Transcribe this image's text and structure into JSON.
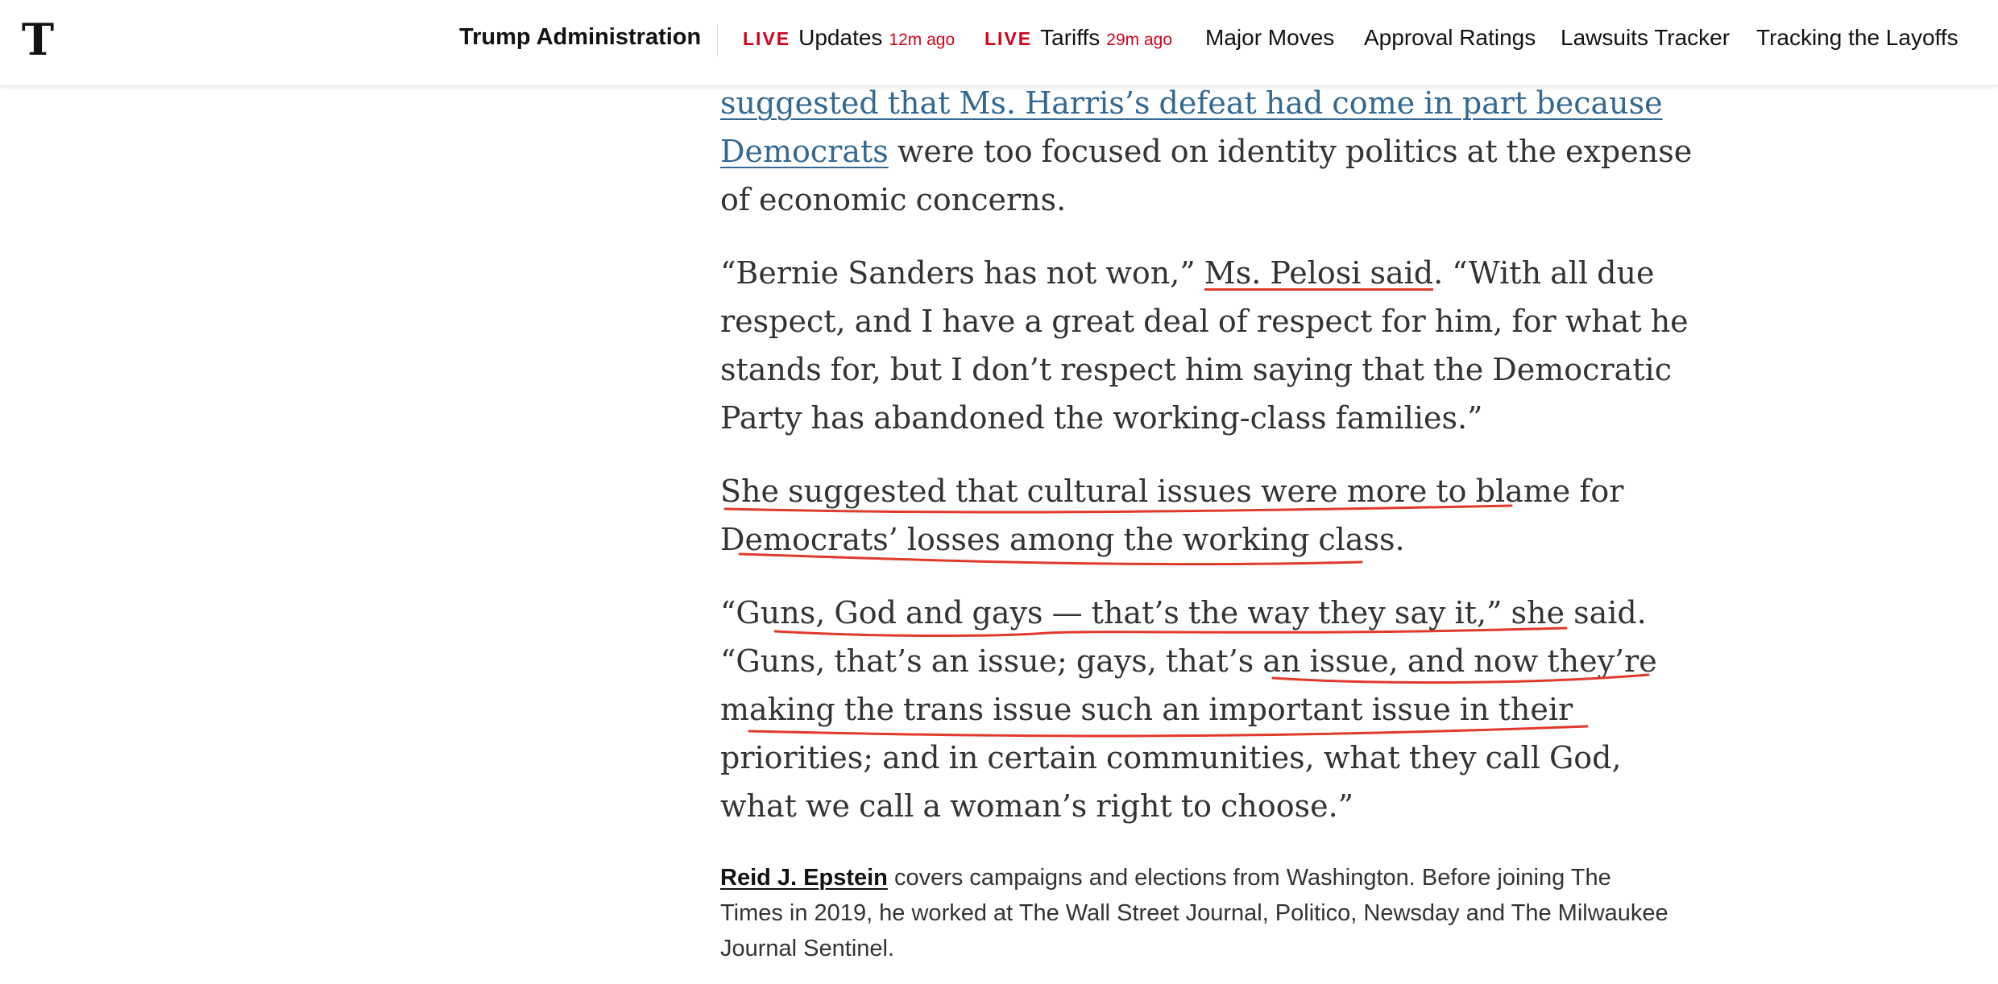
{
  "header": {
    "logo_letter": "T",
    "section_title": "Trump Administration",
    "nav": [
      {
        "live": "LIVE",
        "label": "Updates",
        "time": "12m ago"
      },
      {
        "live": "LIVE",
        "label": "Tariffs",
        "time": "29m ago"
      },
      {
        "label": "Major Moves"
      },
      {
        "label": "Approval Ratings"
      },
      {
        "label": "Lawsuits Tracker"
      },
      {
        "label": "Tracking the Layoffs"
      }
    ]
  },
  "article": {
    "p1": {
      "link_line1": "suggested that Ms. Harris’s defeat had come in part because",
      "link_line2": "Democrats",
      "rest": " were too focused on identity politics at the expense of economic concerns."
    },
    "p2": {
      "a": "“Bernie Sanders has not won,” ",
      "marked": "Ms. Pelosi said",
      "b": ". “With all due respect, and I have a great deal of respect for him, for what he stands for, but I don’t respect him saying that the Democratic Party has abandoned the working-class families.”"
    },
    "p3": {
      "text": "She suggested that cultural issues were more to blame for Democrats’ losses among the working class."
    },
    "p4": {
      "text": "“Guns, God and gays — that’s the way they say it,” she said. “Guns, that’s an issue; gays, that’s an issue, and now they’re making the trans issue such an important issue in their priorities; and in certain communities, what they call God, what we call a woman’s right to choose.”"
    }
  },
  "bio": {
    "author": "Reid J. Epstein",
    "text": " covers campaigns and elections from Washington. Before joining The Times in 2019, he worked at The Wall Street Journal, Politico, Newsday and The Milwaukee Journal Sentinel."
  },
  "colors": {
    "live_red": "#d0021b",
    "link_blue": "#326891",
    "annotation_red": "#e03a2c"
  }
}
